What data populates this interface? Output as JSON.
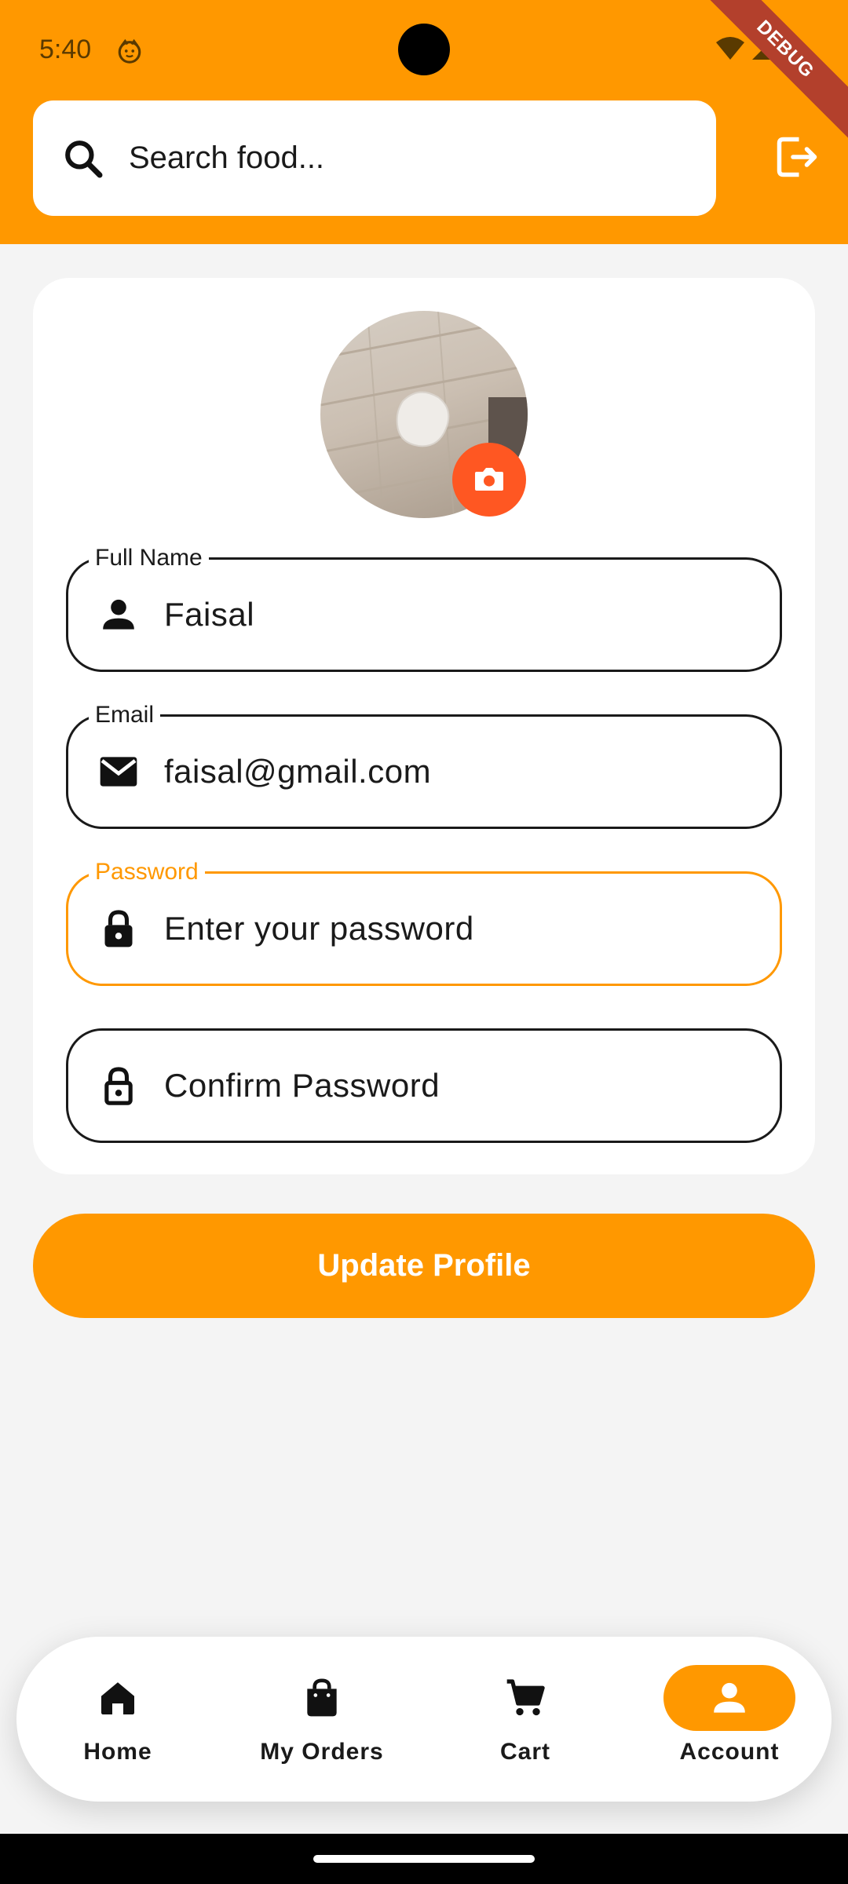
{
  "status_bar": {
    "time": "5:40",
    "debug_label": "DEBUG"
  },
  "header": {
    "search_placeholder": "Search food..."
  },
  "profile": {
    "fields": [
      {
        "label": "Full Name",
        "value": "Faisal"
      },
      {
        "label": "Email",
        "value": "faisal@gmail.com"
      },
      {
        "label": "Password",
        "value": "Enter your password"
      },
      {
        "label": "",
        "value": "Confirm Password"
      }
    ],
    "update_button": "Update Profile"
  },
  "bottom_nav": {
    "items": [
      {
        "label": "Home",
        "icon": "home-icon"
      },
      {
        "label": "My Orders",
        "icon": "shopping-bag-icon"
      },
      {
        "label": "Cart",
        "icon": "cart-icon"
      },
      {
        "label": "Account",
        "icon": "person-icon",
        "active": true
      }
    ]
  },
  "colors": {
    "primary": "#ff9800",
    "accent": "#ff5722",
    "background": "#f4f4f4"
  }
}
